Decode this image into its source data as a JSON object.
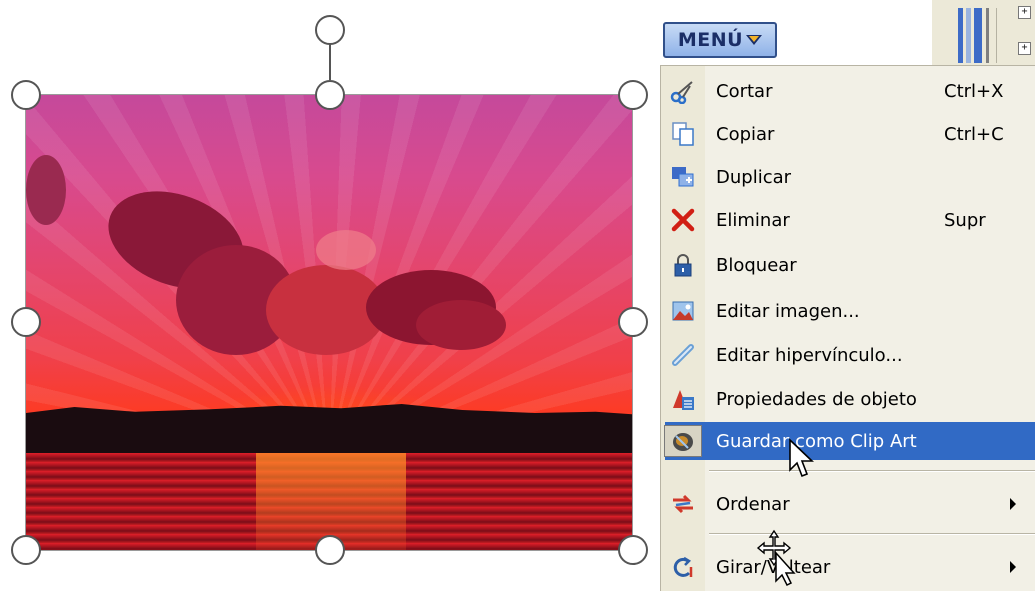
{
  "menu_button": {
    "label": "MENÚ"
  },
  "context_menu": {
    "items": [
      {
        "label": "Cortar",
        "shortcut": "Ctrl+X",
        "icon": "scissors-icon",
        "color": "#2b6fc9"
      },
      {
        "label": "Copiar",
        "shortcut": "Ctrl+C",
        "icon": "copy-icon",
        "color": "#3a78c8"
      },
      {
        "label": "Duplicar",
        "shortcut": "",
        "icon": "duplicate-icon",
        "color": "#2f6fd0"
      },
      {
        "label": "Eliminar",
        "shortcut": "Supr",
        "icon": "delete-x-icon",
        "color": "#d11f14"
      },
      {
        "label": "Bloquear",
        "shortcut": "",
        "icon": "lock-icon",
        "color": "#2d5fa8"
      },
      {
        "label": "Editar imagen...",
        "shortcut": "",
        "icon": "edit-image-icon",
        "color": "#c63a2b"
      },
      {
        "label": "Editar hipervínculo...",
        "shortcut": "",
        "icon": "hyperlink-icon",
        "color": "#6aa0d6"
      },
      {
        "label": "Propiedades de objeto",
        "shortcut": "",
        "icon": "object-properties-icon",
        "color": "#d0392b"
      },
      {
        "label": "Guardar como Clip Art",
        "shortcut": "",
        "icon": "clip-art-icon",
        "color": "#c88b2b",
        "highlighted": true
      },
      {
        "label": "Ordenar",
        "shortcut": "",
        "icon": "arrange-icon",
        "color": "#d0392b",
        "submenu": true
      },
      {
        "label": "Girar/Voltear",
        "shortcut": "",
        "icon": "rotate-flip-icon",
        "color": "#2d5fa8",
        "submenu": true
      }
    ]
  },
  "colors": {
    "highlight": "#316ac5",
    "menu_bg": "#f2f0e6",
    "icon_column": "#ece9d8"
  }
}
